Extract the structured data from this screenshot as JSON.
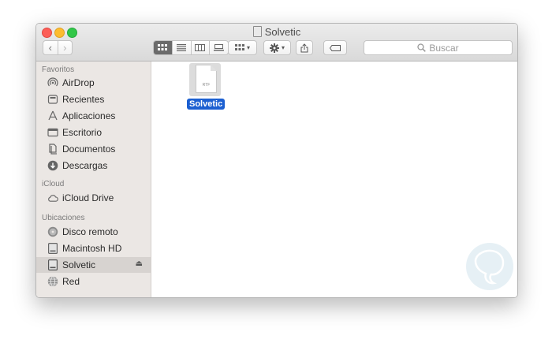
{
  "window": {
    "title": "Solvetic"
  },
  "toolbar": {
    "back_glyph": "‹",
    "forward_glyph": "›",
    "search_placeholder": "Buscar",
    "view_modes": [
      "icon-view",
      "list-view",
      "column-view",
      "gallery-view"
    ],
    "caret": "▾"
  },
  "sidebar": {
    "sections": [
      {
        "header": "Favoritos",
        "items": [
          {
            "label": "AirDrop",
            "icon": "airdrop-icon"
          },
          {
            "label": "Recientes",
            "icon": "recents-icon"
          },
          {
            "label": "Aplicaciones",
            "icon": "applications-icon"
          },
          {
            "label": "Escritorio",
            "icon": "desktop-icon"
          },
          {
            "label": "Documentos",
            "icon": "documents-icon"
          },
          {
            "label": "Descargas",
            "icon": "downloads-icon"
          }
        ]
      },
      {
        "header": "iCloud",
        "items": [
          {
            "label": "iCloud Drive",
            "icon": "cloud-icon"
          }
        ]
      },
      {
        "header": "Ubicaciones",
        "items": [
          {
            "label": "Disco remoto",
            "icon": "remote-disc-icon"
          },
          {
            "label": "Macintosh HD",
            "icon": "hard-drive-icon"
          },
          {
            "label": "Solvetic",
            "icon": "external-drive-icon",
            "selected": true,
            "eject": "⏏"
          },
          {
            "label": "Red",
            "icon": "network-icon"
          }
        ]
      }
    ]
  },
  "files": [
    {
      "name": "Solvetic",
      "type_label": "RTF",
      "selected": true
    }
  ],
  "colors": {
    "selection": "#1b5fd1",
    "sidebar_bg": "#ebe7e4",
    "close": "#fc5e57",
    "minimize": "#fdbc2e",
    "maximize": "#32c748"
  }
}
